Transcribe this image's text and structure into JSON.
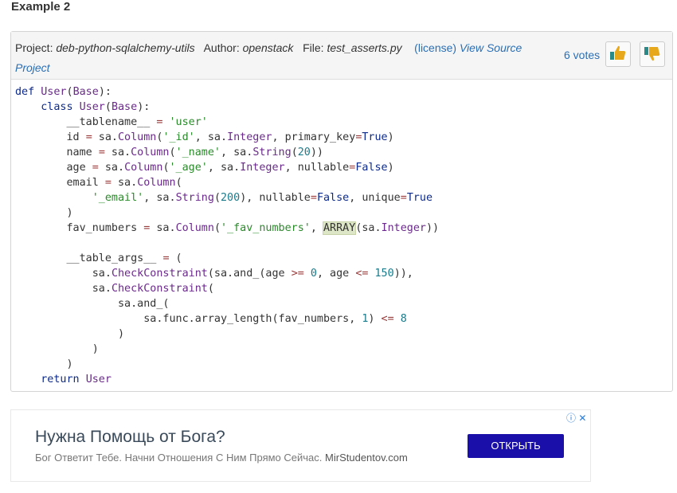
{
  "example_title": "Example 2",
  "meta": {
    "project_label": "Project:",
    "project_name": "deb-python-sqlalchemy-utils",
    "author_label": "Author:",
    "author_name": "openstack",
    "file_label": "File:",
    "file_name": "test_asserts.py",
    "license_link": "(license)",
    "view_source_link": "View Source Project",
    "votes": "6 votes"
  },
  "code_lines": [
    "def User(Base):",
    "    class User(Base):",
    "        __tablename__ = 'user'",
    "        id = sa.Column('_id', sa.Integer, primary_key=True)",
    "        name = sa.Column('_name', sa.String(20))",
    "        age = sa.Column('_age', sa.Integer, nullable=False)",
    "        email = sa.Column(",
    "            '_email', sa.String(200), nullable=False, unique=True",
    "        )",
    "        fav_numbers = sa.Column('_fav_numbers', ARRAY(sa.Integer))",
    "",
    "        __table_args__ = (",
    "            sa.CheckConstraint(sa.and_(age >= 0, age <= 150)),",
    "            sa.CheckConstraint(",
    "                sa.and_(",
    "                    sa.func.array_length(fav_numbers, 1) <= 8",
    "                )",
    "            )",
    "        )",
    "    return User"
  ],
  "ad": {
    "title": "Нужна Помощь от Бога?",
    "subtitle": "Бог Ответит Тебе. Начни Отношения С Ним Прямо Сейчас.",
    "domain": "MirStudentov.com",
    "button": "ОТКРЫТЬ",
    "info_icon": "info-icon",
    "close_icon": "close-icon"
  },
  "colors": {
    "link": "#2a6fb5",
    "ad_button": "#1a0fa8",
    "keyword": "#0c2a8a"
  }
}
